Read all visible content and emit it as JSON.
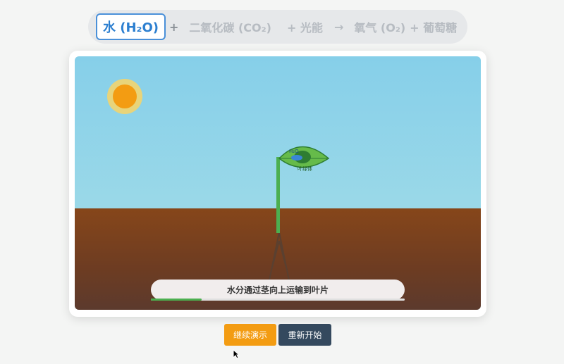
{
  "equation": {
    "water": "水 (H₂O)",
    "plus1": "+",
    "co2": "二氧化碳 (CO₂)",
    "light": "+ 光能",
    "arrow": "→",
    "o2": "氧气 (O₂)",
    "glucose": "+ 葡萄糖"
  },
  "scene": {
    "leaf_label_water": "H₂O",
    "leaf_label_chloroplast": "叶绿体",
    "status_text": "水分通过茎向上运输到叶片",
    "progress": 0.2
  },
  "buttons": {
    "continue_label": "继续演示",
    "restart_label": "重新开始"
  },
  "colors": {
    "accent_blue": "#4a90d9",
    "sun": "#f39c12",
    "stem": "#4caf50",
    "restart": "#34495e"
  }
}
